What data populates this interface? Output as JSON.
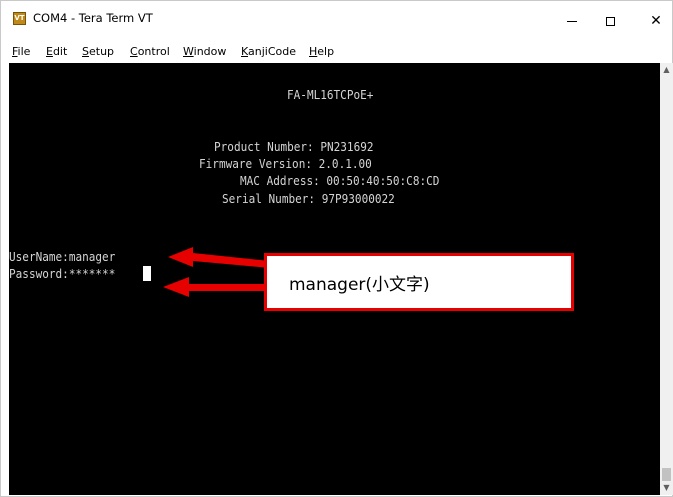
{
  "window": {
    "title": "COM4 - Tera Term VT",
    "app_icon_label": "VT",
    "close_glyph": "✕"
  },
  "menu": {
    "items": [
      {
        "first": "F",
        "rest": "ile"
      },
      {
        "first": "E",
        "rest": "dit"
      },
      {
        "first": "S",
        "rest": "etup"
      },
      {
        "first": "C",
        "rest": "ontrol"
      },
      {
        "first": "W",
        "rest": "indow"
      },
      {
        "first": "K",
        "rest": "anjiCode"
      },
      {
        "first": "H",
        "rest": "elp"
      }
    ]
  },
  "terminal": {
    "lines": [
      "FA-ML16TCPoE+",
      "Product Number: PN231692",
      "Firmware Version: 2.0.1.00",
      "MAC Address: 00:50:40:50:C8:CD",
      "Serial Number: 97P93000022",
      "UserName:manager",
      "Password:*******"
    ]
  },
  "annotation": {
    "callout_text": "manager(小文字)",
    "color": "#e60000"
  },
  "scrollbar": {
    "up_glyph": "▲",
    "down_glyph": "▼"
  }
}
